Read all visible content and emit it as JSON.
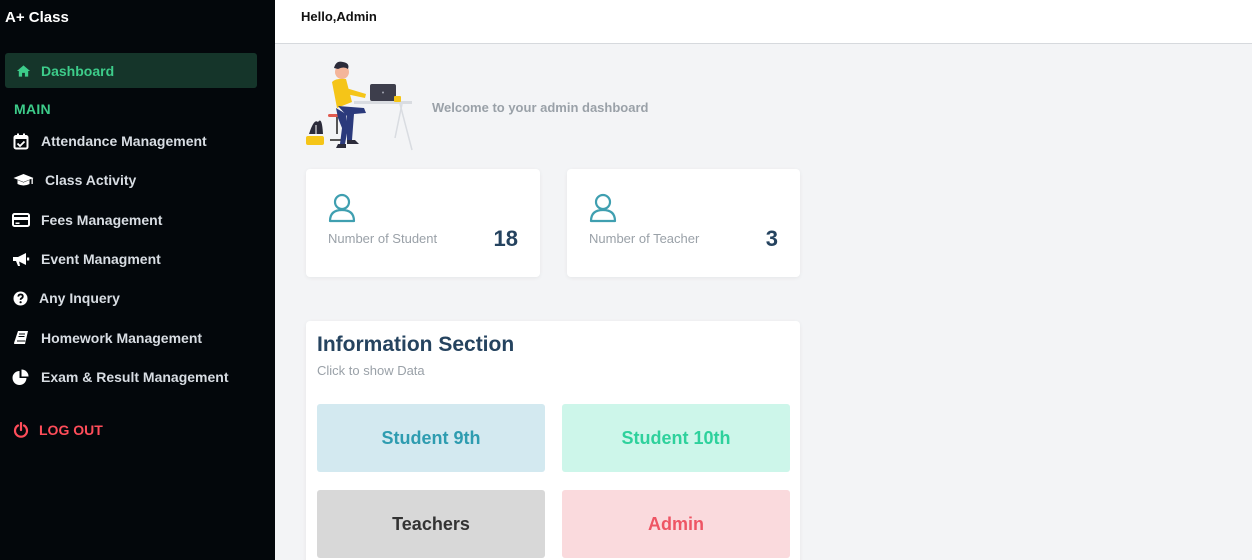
{
  "sidebar": {
    "brand": "A+ Class",
    "active": {
      "label": "Dashboard",
      "icon": "home-icon"
    },
    "section_label": "MAIN",
    "items": [
      {
        "label": "Attendance Management",
        "icon": "calendar-check-icon"
      },
      {
        "label": "Class Activity",
        "icon": "graduation-cap-icon"
      },
      {
        "label": "Fees Management",
        "icon": "credit-card-icon"
      },
      {
        "label": "Event Managment",
        "icon": "megaphone-icon"
      },
      {
        "label": "Any Inquery",
        "icon": "question-circle-icon"
      },
      {
        "label": "Homework Management",
        "icon": "book-icon"
      },
      {
        "label": "Exam & Result Management",
        "icon": "pie-chart-icon"
      }
    ],
    "logout": {
      "label": "LOG OUT",
      "icon": "power-icon"
    }
  },
  "header": {
    "greeting": "Hello,Admin"
  },
  "welcome": {
    "text": "Welcome to your admin dashboard"
  },
  "stats": [
    {
      "label": "Number of Student",
      "value": "18",
      "icon": "user-icon"
    },
    {
      "label": "Number of Teacher",
      "value": "3",
      "icon": "user-icon"
    }
  ],
  "info": {
    "title": "Information Section",
    "subtitle": "Click to show Data",
    "tiles": [
      {
        "label": "Student 9th"
      },
      {
        "label": "Student 10th"
      },
      {
        "label": "Teachers"
      },
      {
        "label": "Admin"
      }
    ]
  },
  "colors": {
    "sidebar_bg": "#03070b",
    "accent_green": "#3dcc8a",
    "logout_red": "#ff4d5a",
    "heading_navy": "#25435f"
  }
}
